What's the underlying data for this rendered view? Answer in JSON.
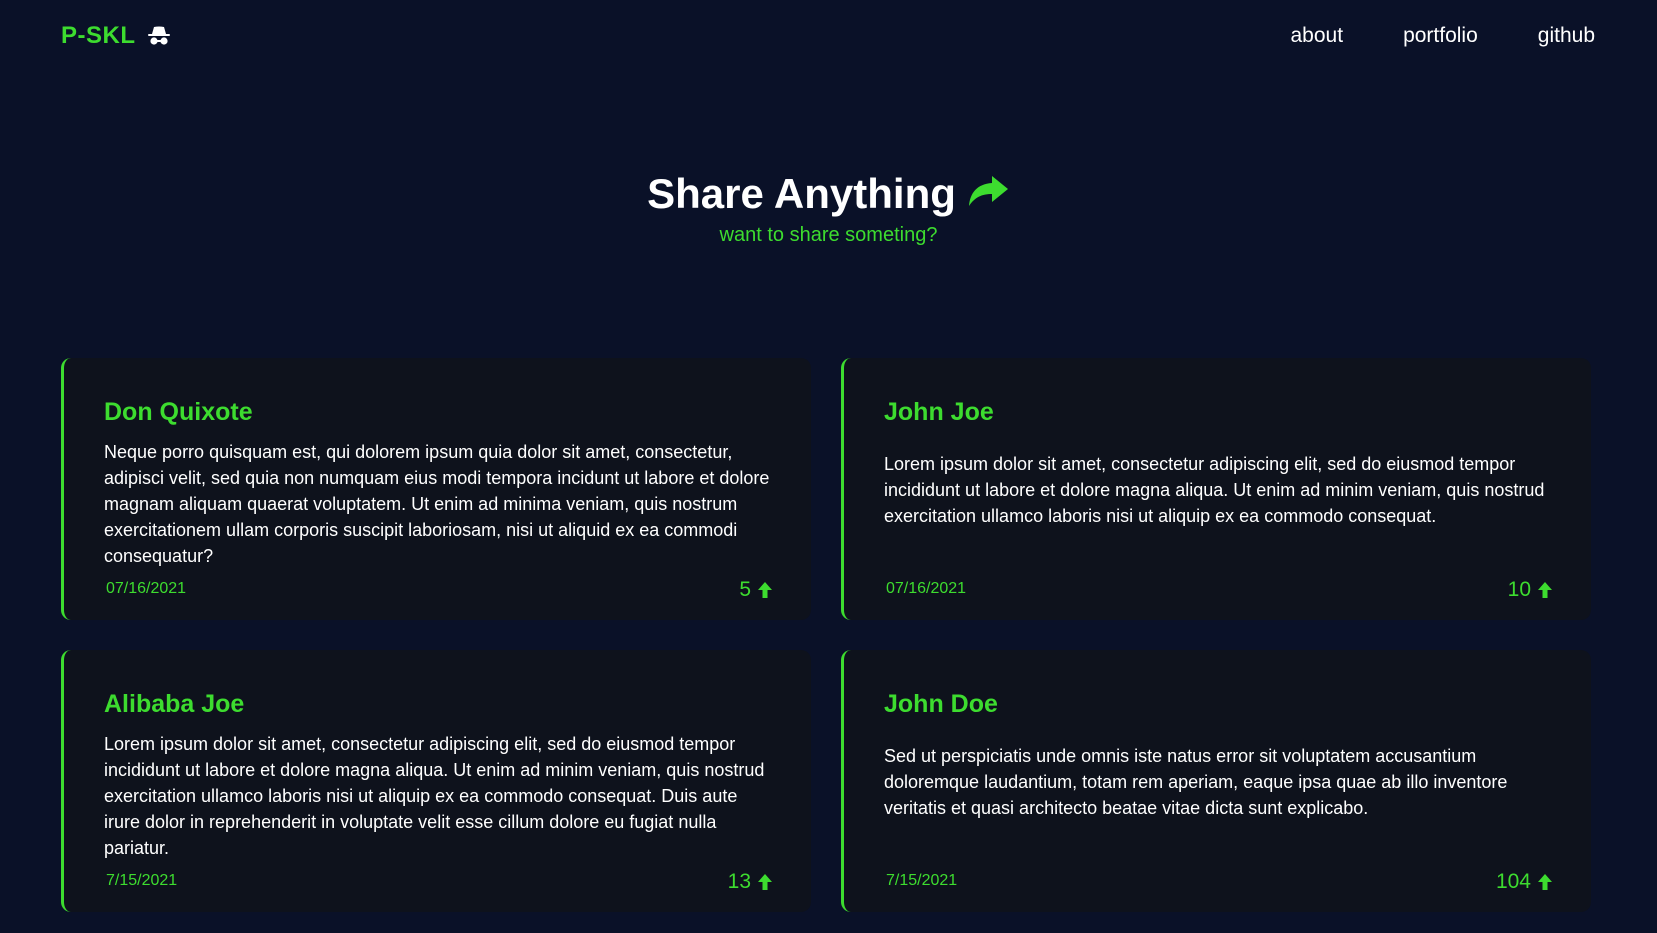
{
  "colors": {
    "accent": "#3ddc2f",
    "background": "#0a1128",
    "card": "#0e121c",
    "text": "#ffffff"
  },
  "nav": {
    "brand": "P-SKL",
    "brand_icon": "incognito-icon",
    "links": [
      {
        "label": "about"
      },
      {
        "label": "portfolio"
      },
      {
        "label": "github"
      }
    ]
  },
  "hero": {
    "title": "Share Anything",
    "title_icon": "share-arrow-icon",
    "subtitle": "want to share someting?"
  },
  "posts": [
    {
      "author": "Don Quixote",
      "body": "Neque porro quisquam est, qui dolorem ipsum quia dolor sit amet, consectetur, adipisci velit, sed quia non numquam eius modi tempora incidunt ut labore et dolore magnam aliquam quaerat voluptatem. Ut enim ad minima veniam, quis nostrum exercitationem ullam corporis suscipit laboriosam, nisi ut aliquid ex ea commodi consequatur?",
      "date": "07/16/2021",
      "votes": "5",
      "vote_icon": "arrow-up-icon"
    },
    {
      "author": "John Joe",
      "body": "Lorem ipsum dolor sit amet, consectetur adipiscing elit, sed do eiusmod tempor incididunt ut labore et dolore magna aliqua. Ut enim ad minim veniam, quis nostrud exercitation ullamco laboris nisi ut aliquip ex ea commodo consequat.",
      "date": "07/16/2021",
      "votes": "10",
      "vote_icon": "arrow-up-icon"
    },
    {
      "author": "Alibaba Joe",
      "body": "Lorem ipsum dolor sit amet, consectetur adipiscing elit, sed do eiusmod tempor incididunt ut labore et dolore magna aliqua. Ut enim ad minim veniam, quis nostrud exercitation ullamco laboris nisi ut aliquip ex ea commodo consequat. Duis aute irure dolor in reprehenderit in voluptate velit esse cillum dolore eu fugiat nulla pariatur.",
      "date": "7/15/2021",
      "votes": "13",
      "vote_icon": "arrow-up-icon"
    },
    {
      "author": "John Doe",
      "body": "Sed ut perspiciatis unde omnis iste natus error sit voluptatem accusantium doloremque laudantium, totam rem aperiam, eaque ipsa quae ab illo inventore veritatis et quasi architecto beatae vitae dicta sunt explicabo.",
      "date": "7/15/2021",
      "votes": "104",
      "vote_icon": "arrow-up-icon"
    }
  ]
}
